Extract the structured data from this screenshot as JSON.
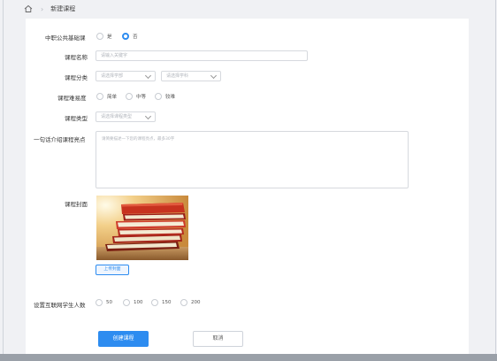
{
  "breadcrumb": {
    "current": "新建课程"
  },
  "form": {
    "public_basic": {
      "label": "中职公共基础课",
      "options": [
        "是",
        "否"
      ],
      "selected": "否"
    },
    "course_name": {
      "label": "课程名称",
      "placeholder": "请输入关键字"
    },
    "category": {
      "label": "课程分类",
      "select1_placeholder": "请选择学部",
      "select2_placeholder": "请选择学科"
    },
    "difficulty": {
      "label": "课程难易度",
      "options": [
        "简单",
        "中等",
        "较难"
      ]
    },
    "course_type": {
      "label": "课程类型",
      "placeholder": "请选择课程类型"
    },
    "highlight": {
      "label": "一句话介绍课程亮点",
      "placeholder": "请简要描述一下您的课程亮点，最多30字"
    },
    "cover": {
      "label": "课程封面",
      "upload_label": "上传封面"
    },
    "max_students": {
      "label": "设置互联网学生人数",
      "options": [
        "50",
        "100",
        "150",
        "200"
      ]
    }
  },
  "actions": {
    "create_label": "创建课程",
    "cancel_label": "取消"
  },
  "colors": {
    "accent": "#2d8cf0"
  }
}
